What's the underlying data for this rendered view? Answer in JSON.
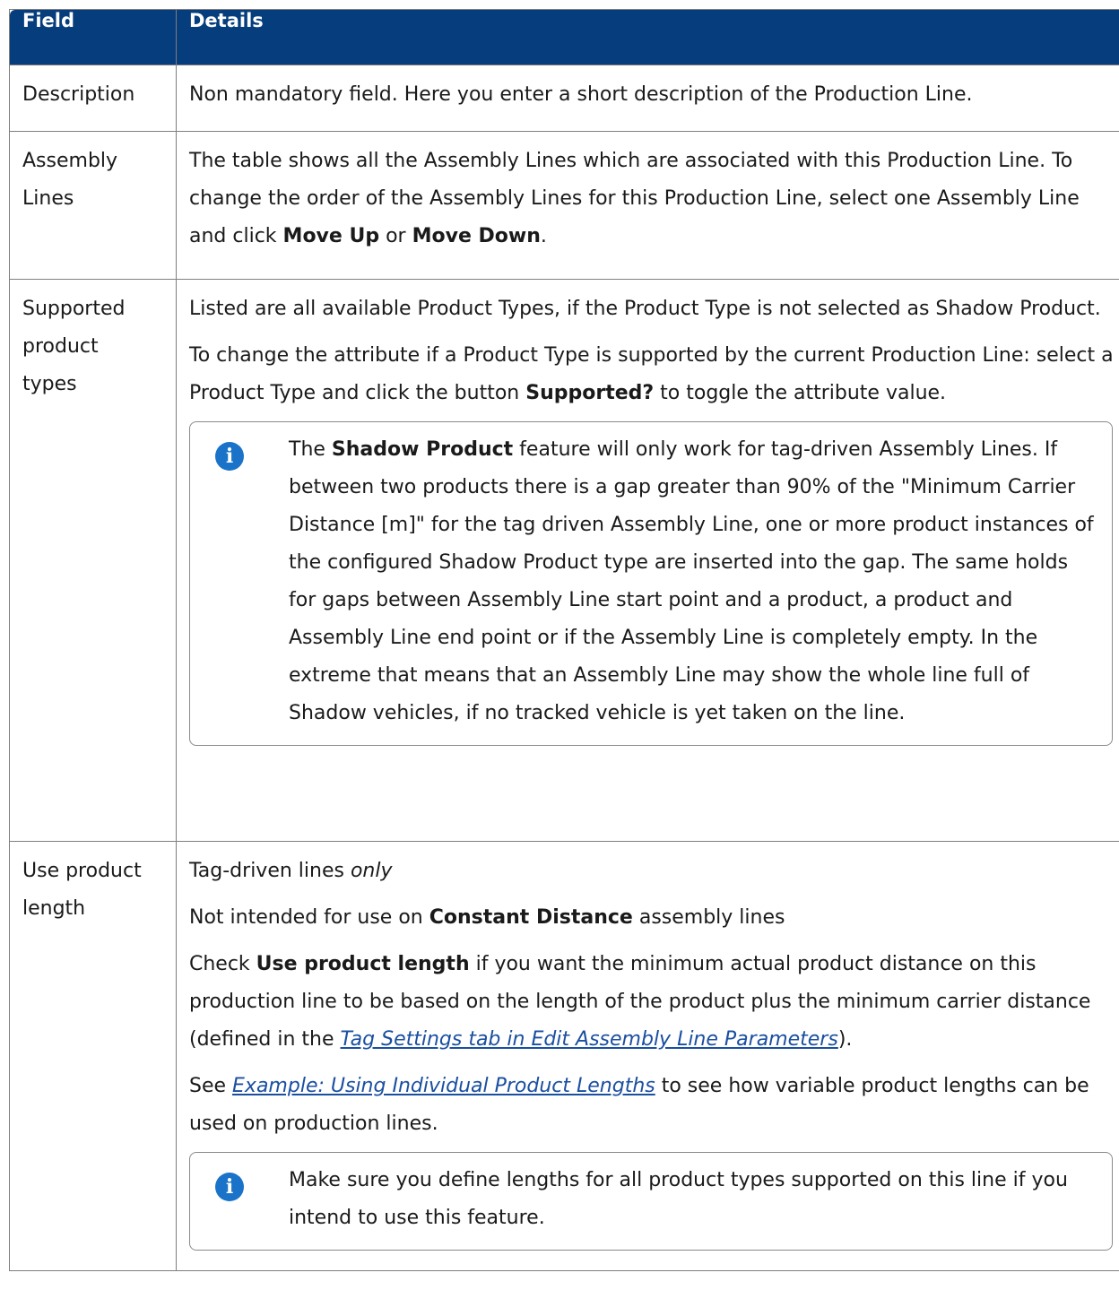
{
  "table": {
    "header": {
      "field": "Field",
      "details": "Details"
    },
    "rows": [
      {
        "field": "Description",
        "p1": "Non mandatory field. Here you enter a short description of the Production Line."
      },
      {
        "field_a": "Assembly",
        "field_b": "Lines",
        "p1_a": "The table shows all the Assembly Lines which are associated with this Production Line. To change the order of the Assembly Lines for this Production Line, select one Assembly Line and click ",
        "p1_b1": "Move Up",
        "p1_c": " or ",
        "p1_b2": "Move Down",
        "p1_d": "."
      },
      {
        "field_a": "Supported",
        "field_b": "product",
        "field_c": "types",
        "p1": "Listed are all available Product Types, if the Product Type is not selected as Shadow Product.",
        "p2_a": "To change the attribute if a Product Type is supported by the current Production Line: select a Product Type and click the button ",
        "p2_b": "Supported?",
        "p2_c": " to toggle the attribute value.",
        "note_a": "The ",
        "note_b": "Shadow Product",
        "note_c": " feature will only work for tag-driven Assembly Lines. If between two products there is a gap greater than 90% of the \"Minimum Carrier Distance [m]\" for the tag driven Assembly Line, one or more product instances of the configured Shadow Product type are inserted into the gap. The same holds for gaps between Assembly Line start point and a product, a product and Assembly Line end point or if the Assembly Line is completely empty. In the extreme that means that an Assembly Line may show the whole line full of Shadow vehicles, if no tracked vehicle is yet taken on the line."
      },
      {
        "field_a": "Use product",
        "field_b": "length",
        "p1_a": "Tag-driven lines ",
        "p1_b": "only",
        "p2_a": "Not intended for use on ",
        "p2_b": "Constant Distance",
        "p2_c": " assembly lines",
        "p3_a": "Check ",
        "p3_b": "Use product length",
        "p3_c": " if you want the minimum actual product distance on this production line to be based on the length of the product plus the minimum carrier distance (defined in the ",
        "p3_link": "Tag Settings tab in Edit Assembly Line Parameters",
        "p3_d": ").",
        "p4_a": "See ",
        "p4_link": "Example: Using Individual Product Lengths",
        "p4_b": " to see how variable product lengths can be used on production lines.",
        "note": "Make sure you define lengths for all product types supported on this line if you intend to use this feature."
      }
    ]
  },
  "icons": {
    "info": "info-icon",
    "info_glyph": "i",
    "info_color": "#1a73c8"
  },
  "colors": {
    "header_bg": "#063d7d",
    "header_text": "#ffffff",
    "link": "#1a4fa0"
  }
}
